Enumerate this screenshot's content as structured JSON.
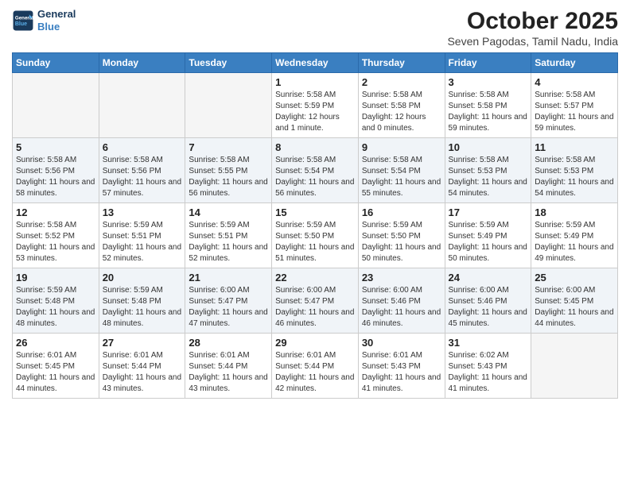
{
  "header": {
    "logo_line1": "General",
    "logo_line2": "Blue",
    "title": "October 2025",
    "subtitle": "Seven Pagodas, Tamil Nadu, India"
  },
  "days_of_week": [
    "Sunday",
    "Monday",
    "Tuesday",
    "Wednesday",
    "Thursday",
    "Friday",
    "Saturday"
  ],
  "weeks": [
    [
      {
        "day": "",
        "empty": true
      },
      {
        "day": "",
        "empty": true
      },
      {
        "day": "",
        "empty": true
      },
      {
        "day": "1",
        "sunrise": "Sunrise: 5:58 AM",
        "sunset": "Sunset: 5:59 PM",
        "daylight": "Daylight: 12 hours and 1 minute."
      },
      {
        "day": "2",
        "sunrise": "Sunrise: 5:58 AM",
        "sunset": "Sunset: 5:58 PM",
        "daylight": "Daylight: 12 hours and 0 minutes."
      },
      {
        "day": "3",
        "sunrise": "Sunrise: 5:58 AM",
        "sunset": "Sunset: 5:58 PM",
        "daylight": "Daylight: 11 hours and 59 minutes."
      },
      {
        "day": "4",
        "sunrise": "Sunrise: 5:58 AM",
        "sunset": "Sunset: 5:57 PM",
        "daylight": "Daylight: 11 hours and 59 minutes."
      }
    ],
    [
      {
        "day": "5",
        "sunrise": "Sunrise: 5:58 AM",
        "sunset": "Sunset: 5:56 PM",
        "daylight": "Daylight: 11 hours and 58 minutes."
      },
      {
        "day": "6",
        "sunrise": "Sunrise: 5:58 AM",
        "sunset": "Sunset: 5:56 PM",
        "daylight": "Daylight: 11 hours and 57 minutes."
      },
      {
        "day": "7",
        "sunrise": "Sunrise: 5:58 AM",
        "sunset": "Sunset: 5:55 PM",
        "daylight": "Daylight: 11 hours and 56 minutes."
      },
      {
        "day": "8",
        "sunrise": "Sunrise: 5:58 AM",
        "sunset": "Sunset: 5:54 PM",
        "daylight": "Daylight: 11 hours and 56 minutes."
      },
      {
        "day": "9",
        "sunrise": "Sunrise: 5:58 AM",
        "sunset": "Sunset: 5:54 PM",
        "daylight": "Daylight: 11 hours and 55 minutes."
      },
      {
        "day": "10",
        "sunrise": "Sunrise: 5:58 AM",
        "sunset": "Sunset: 5:53 PM",
        "daylight": "Daylight: 11 hours and 54 minutes."
      },
      {
        "day": "11",
        "sunrise": "Sunrise: 5:58 AM",
        "sunset": "Sunset: 5:53 PM",
        "daylight": "Daylight: 11 hours and 54 minutes."
      }
    ],
    [
      {
        "day": "12",
        "sunrise": "Sunrise: 5:58 AM",
        "sunset": "Sunset: 5:52 PM",
        "daylight": "Daylight: 11 hours and 53 minutes."
      },
      {
        "day": "13",
        "sunrise": "Sunrise: 5:59 AM",
        "sunset": "Sunset: 5:51 PM",
        "daylight": "Daylight: 11 hours and 52 minutes."
      },
      {
        "day": "14",
        "sunrise": "Sunrise: 5:59 AM",
        "sunset": "Sunset: 5:51 PM",
        "daylight": "Daylight: 11 hours and 52 minutes."
      },
      {
        "day": "15",
        "sunrise": "Sunrise: 5:59 AM",
        "sunset": "Sunset: 5:50 PM",
        "daylight": "Daylight: 11 hours and 51 minutes."
      },
      {
        "day": "16",
        "sunrise": "Sunrise: 5:59 AM",
        "sunset": "Sunset: 5:50 PM",
        "daylight": "Daylight: 11 hours and 50 minutes."
      },
      {
        "day": "17",
        "sunrise": "Sunrise: 5:59 AM",
        "sunset": "Sunset: 5:49 PM",
        "daylight": "Daylight: 11 hours and 50 minutes."
      },
      {
        "day": "18",
        "sunrise": "Sunrise: 5:59 AM",
        "sunset": "Sunset: 5:49 PM",
        "daylight": "Daylight: 11 hours and 49 minutes."
      }
    ],
    [
      {
        "day": "19",
        "sunrise": "Sunrise: 5:59 AM",
        "sunset": "Sunset: 5:48 PM",
        "daylight": "Daylight: 11 hours and 48 minutes."
      },
      {
        "day": "20",
        "sunrise": "Sunrise: 5:59 AM",
        "sunset": "Sunset: 5:48 PM",
        "daylight": "Daylight: 11 hours and 48 minutes."
      },
      {
        "day": "21",
        "sunrise": "Sunrise: 6:00 AM",
        "sunset": "Sunset: 5:47 PM",
        "daylight": "Daylight: 11 hours and 47 minutes."
      },
      {
        "day": "22",
        "sunrise": "Sunrise: 6:00 AM",
        "sunset": "Sunset: 5:47 PM",
        "daylight": "Daylight: 11 hours and 46 minutes."
      },
      {
        "day": "23",
        "sunrise": "Sunrise: 6:00 AM",
        "sunset": "Sunset: 5:46 PM",
        "daylight": "Daylight: 11 hours and 46 minutes."
      },
      {
        "day": "24",
        "sunrise": "Sunrise: 6:00 AM",
        "sunset": "Sunset: 5:46 PM",
        "daylight": "Daylight: 11 hours and 45 minutes."
      },
      {
        "day": "25",
        "sunrise": "Sunrise: 6:00 AM",
        "sunset": "Sunset: 5:45 PM",
        "daylight": "Daylight: 11 hours and 44 minutes."
      }
    ],
    [
      {
        "day": "26",
        "sunrise": "Sunrise: 6:01 AM",
        "sunset": "Sunset: 5:45 PM",
        "daylight": "Daylight: 11 hours and 44 minutes."
      },
      {
        "day": "27",
        "sunrise": "Sunrise: 6:01 AM",
        "sunset": "Sunset: 5:44 PM",
        "daylight": "Daylight: 11 hours and 43 minutes."
      },
      {
        "day": "28",
        "sunrise": "Sunrise: 6:01 AM",
        "sunset": "Sunset: 5:44 PM",
        "daylight": "Daylight: 11 hours and 43 minutes."
      },
      {
        "day": "29",
        "sunrise": "Sunrise: 6:01 AM",
        "sunset": "Sunset: 5:44 PM",
        "daylight": "Daylight: 11 hours and 42 minutes."
      },
      {
        "day": "30",
        "sunrise": "Sunrise: 6:01 AM",
        "sunset": "Sunset: 5:43 PM",
        "daylight": "Daylight: 11 hours and 41 minutes."
      },
      {
        "day": "31",
        "sunrise": "Sunrise: 6:02 AM",
        "sunset": "Sunset: 5:43 PM",
        "daylight": "Daylight: 11 hours and 41 minutes."
      },
      {
        "day": "",
        "empty": true
      }
    ]
  ]
}
